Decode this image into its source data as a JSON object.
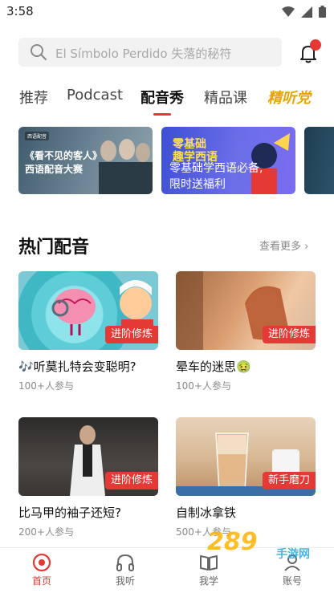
{
  "status_bar": {
    "time": "3:58"
  },
  "search": {
    "placeholder": "El Símbolo Perdido 失落的秘符"
  },
  "tabs": [
    {
      "label": "推荐"
    },
    {
      "label": "Podcast"
    },
    {
      "label": "配音秀",
      "active": true
    },
    {
      "label": "精品课"
    },
    {
      "label": "精听党"
    }
  ],
  "banners": [
    {
      "text_line1": "《看不见的客人》",
      "text_line2": "西语配音大赛"
    },
    {
      "headline_line1": "零基础",
      "headline_line2": "趣学西语",
      "text_line1": "零基础学西语必备,",
      "text_line2": "限时送福利"
    }
  ],
  "section": {
    "title": "热门配音",
    "more_label": "查看更多"
  },
  "cards": [
    {
      "title": "🎶听莫扎特会变聪明?",
      "participants": "100+人参与",
      "level": "进阶修炼"
    },
    {
      "title": "晕车的迷思🤢",
      "participants": "100+人参与",
      "level": "进阶修炼"
    },
    {
      "title": "比马甲的袖子还短?",
      "participants": "200+人参与",
      "level": "进阶修炼"
    },
    {
      "title": "自制冰拿铁",
      "participants": "500+人参与",
      "level": "新手磨刀"
    }
  ],
  "bottom_nav": [
    {
      "label": "首页",
      "icon": "home-icon",
      "active": true
    },
    {
      "label": "我听",
      "icon": "headphones-icon"
    },
    {
      "label": "我学",
      "icon": "book-icon"
    },
    {
      "label": "账号",
      "icon": "account-icon"
    }
  ],
  "watermark": {
    "text": "289",
    "sub": "手游网"
  },
  "colors": {
    "accent": "#e53935",
    "tag_gold": "#e9a400"
  }
}
